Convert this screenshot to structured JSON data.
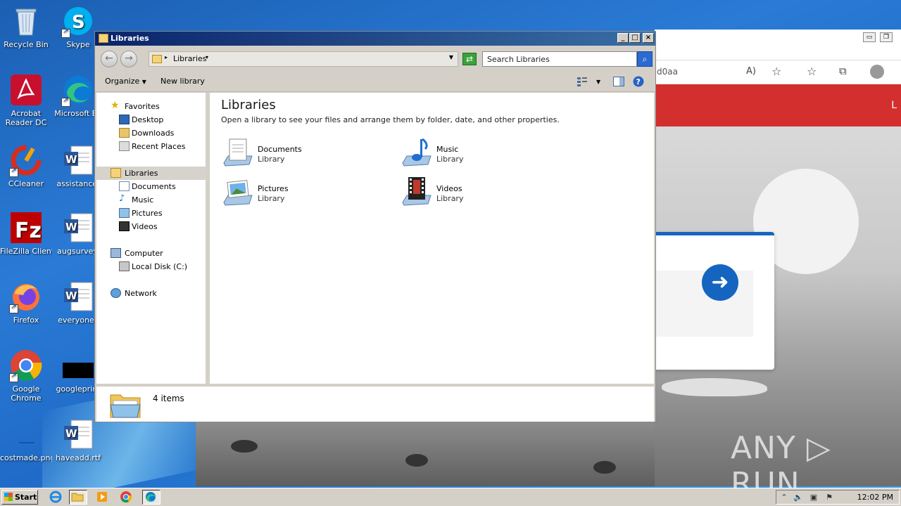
{
  "desktop": {
    "icons_col1": [
      {
        "label": "Recycle Bin",
        "icon": "recycle-bin-icon"
      },
      {
        "label": "Acrobat Reader DC",
        "icon": "acrobat-icon"
      },
      {
        "label": "CCleaner",
        "icon": "ccleaner-icon"
      },
      {
        "label": "FileZilla Client",
        "icon": "filezilla-icon"
      },
      {
        "label": "Firefox",
        "icon": "firefox-icon"
      },
      {
        "label": "Google Chrome",
        "icon": "chrome-icon"
      },
      {
        "label": "costmade.png",
        "icon": "image-file-icon"
      }
    ],
    "icons_col2": [
      {
        "label": "Skype",
        "icon": "skype-icon"
      },
      {
        "label": "Microsoft Ed",
        "icon": "edge-icon"
      },
      {
        "label": "assistance.",
        "icon": "word-doc-icon"
      },
      {
        "label": "augsurvey.",
        "icon": "word-doc-icon"
      },
      {
        "label": "everyonec",
        "icon": "word-doc-icon"
      },
      {
        "label": "googleprint",
        "icon": "black-file-icon"
      },
      {
        "label": "haveadd.rtf",
        "icon": "word-doc-icon"
      }
    ]
  },
  "browser": {
    "url_fragment": "d0aa",
    "header_letter": "L",
    "watermark": "ANY ▷ RUN"
  },
  "window": {
    "title": "Libraries",
    "address": "Libraries",
    "search_placeholder": "Search Libraries",
    "toolbar": {
      "organize": "Organize",
      "new_library": "New library"
    },
    "nav": {
      "favorites": "Favorites",
      "desktop": "Desktop",
      "downloads": "Downloads",
      "recent": "Recent Places",
      "libraries": "Libraries",
      "documents": "Documents",
      "music": "Music",
      "pictures": "Pictures",
      "videos": "Videos",
      "computer": "Computer",
      "local_disk": "Local Disk (C:)",
      "network": "Network"
    },
    "content": {
      "heading": "Libraries",
      "description": "Open a library to see your files and arrange them by folder, date, and other properties.",
      "libraries": [
        {
          "name": "Documents",
          "type": "Library"
        },
        {
          "name": "Music",
          "type": "Library"
        },
        {
          "name": "Pictures",
          "type": "Library"
        },
        {
          "name": "Videos",
          "type": "Library"
        }
      ]
    },
    "details": {
      "count": "4 items"
    }
  },
  "taskbar": {
    "start": "Start",
    "time": "12:02 PM"
  },
  "colors": {
    "titlebar_start": "#0a246a",
    "titlebar_end": "#3a6ea5",
    "accent_red": "#d32f2f",
    "accent_blue": "#1565c0"
  }
}
